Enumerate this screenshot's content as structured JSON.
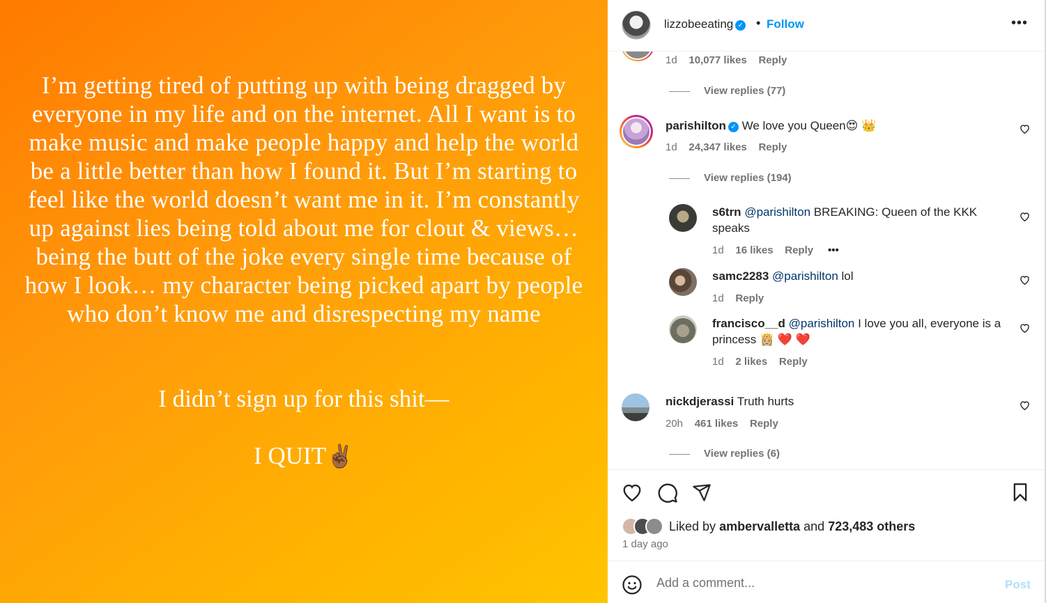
{
  "story": {
    "paragraph": "I’m getting tired of putting up with being dragged by everyone in my life and on the internet. All I want is to make music and make people happy and help the world be a little better than how I found it. But I’m starting to feel like the world doesn’t want me in it. I’m constantly up against lies being told about me for clout & views… being the butt of the joke every single time because of how I look… my character being picked apart by people who don’t know me and disrespecting my name",
    "line2": "I didn’t sign up for this shit—",
    "line3": "I QUIT",
    "line3_emoji": "✌🏾"
  },
  "header": {
    "username": "lizzobeeating",
    "separator": "•",
    "follow_label": "Follow",
    "more_label": "•••"
  },
  "comments": {
    "partial": {
      "age": "1d",
      "likes": "10,077 likes",
      "reply": "Reply",
      "view_replies": "View replies (77)"
    },
    "c1": {
      "user": "parishilton",
      "text": "We love you Queen",
      "emoji": "😍 👑",
      "age": "1d",
      "likes": "24,347 likes",
      "reply": "Reply",
      "view_replies": "View replies (194)"
    },
    "r1": {
      "user": "s6trn",
      "mention": "@parishilton",
      "text": "BREAKING: Queen of the KKK speaks",
      "age": "1d",
      "likes": "16 likes",
      "reply": "Reply",
      "more": "•••"
    },
    "r2": {
      "user": "samc2283",
      "mention": "@parishilton",
      "text": "lol",
      "age": "1d",
      "reply": "Reply"
    },
    "r3": {
      "user": "francisco__d",
      "mention": "@parishilton",
      "text": "I love you all, everyone is a princess",
      "emoji": "👸🏼 ❤️ ❤️",
      "age": "1d",
      "likes": "2 likes",
      "reply": "Reply"
    },
    "c2": {
      "user": "nickdjerassi",
      "text": "Truth hurts",
      "age": "20h",
      "likes": "461 likes",
      "reply": "Reply",
      "view_replies": "View replies (6)"
    }
  },
  "likes": {
    "prefix": "Liked by",
    "user": "ambervalletta",
    "middle": "and",
    "others": "723,483 others",
    "time": "1 day ago"
  },
  "comment_box": {
    "placeholder": "Add a comment...",
    "post_label": "Post"
  },
  "colors": {
    "accent": "#0095f6",
    "muted": "#737373",
    "story_start": "#ff7a00",
    "story_end": "#ffc400"
  }
}
